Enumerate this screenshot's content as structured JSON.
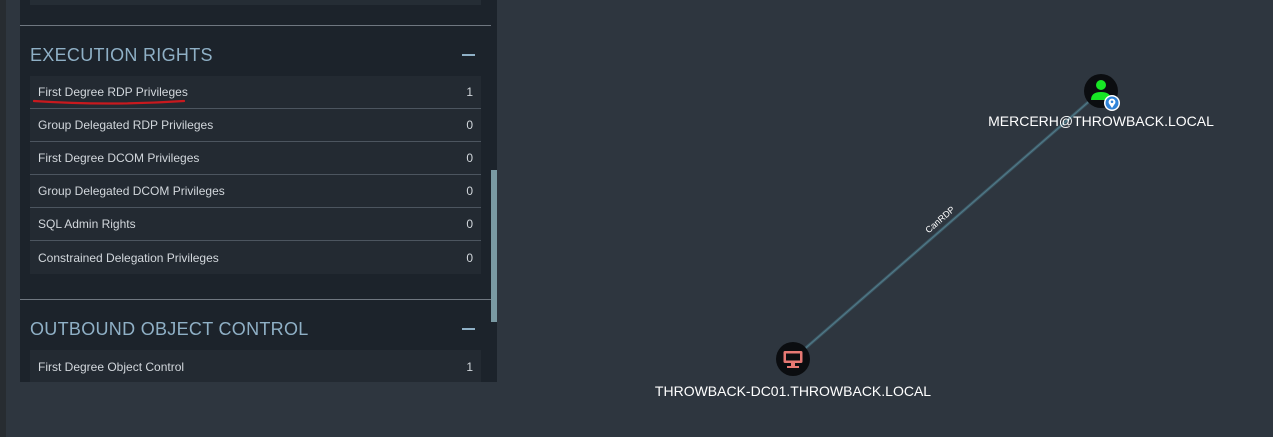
{
  "execution_rights": {
    "title": "EXECUTION RIGHTS",
    "rows": [
      {
        "label": "First Degree RDP Privileges",
        "count": "1"
      },
      {
        "label": "Group Delegated RDP Privileges",
        "count": "0"
      },
      {
        "label": "First Degree DCOM Privileges",
        "count": "0"
      },
      {
        "label": "Group Delegated DCOM Privileges",
        "count": "0"
      },
      {
        "label": "SQL Admin Rights",
        "count": "0"
      },
      {
        "label": "Constrained Delegation Privileges",
        "count": "0"
      }
    ]
  },
  "outbound_object_control": {
    "title": "OUTBOUND OBJECT CONTROL",
    "rows": [
      {
        "label": "First Degree Object Control",
        "count": "1"
      }
    ]
  },
  "graph": {
    "user_node": {
      "label": "MERCERH@THROWBACK.LOCAL",
      "icon": "user-icon",
      "color": "#17e625",
      "badge_icon": "map-marker-icon"
    },
    "computer_node": {
      "label": "THROWBACK-DC01.THROWBACK.LOCAL",
      "icon": "computer-icon",
      "color": "#e67873"
    },
    "edge": {
      "label": "CanRDP"
    }
  },
  "colors": {
    "background": "#2e363f",
    "panel": "#1c232b",
    "section_title": "#8fb0c6",
    "annotation_underline": "#c8191e"
  }
}
